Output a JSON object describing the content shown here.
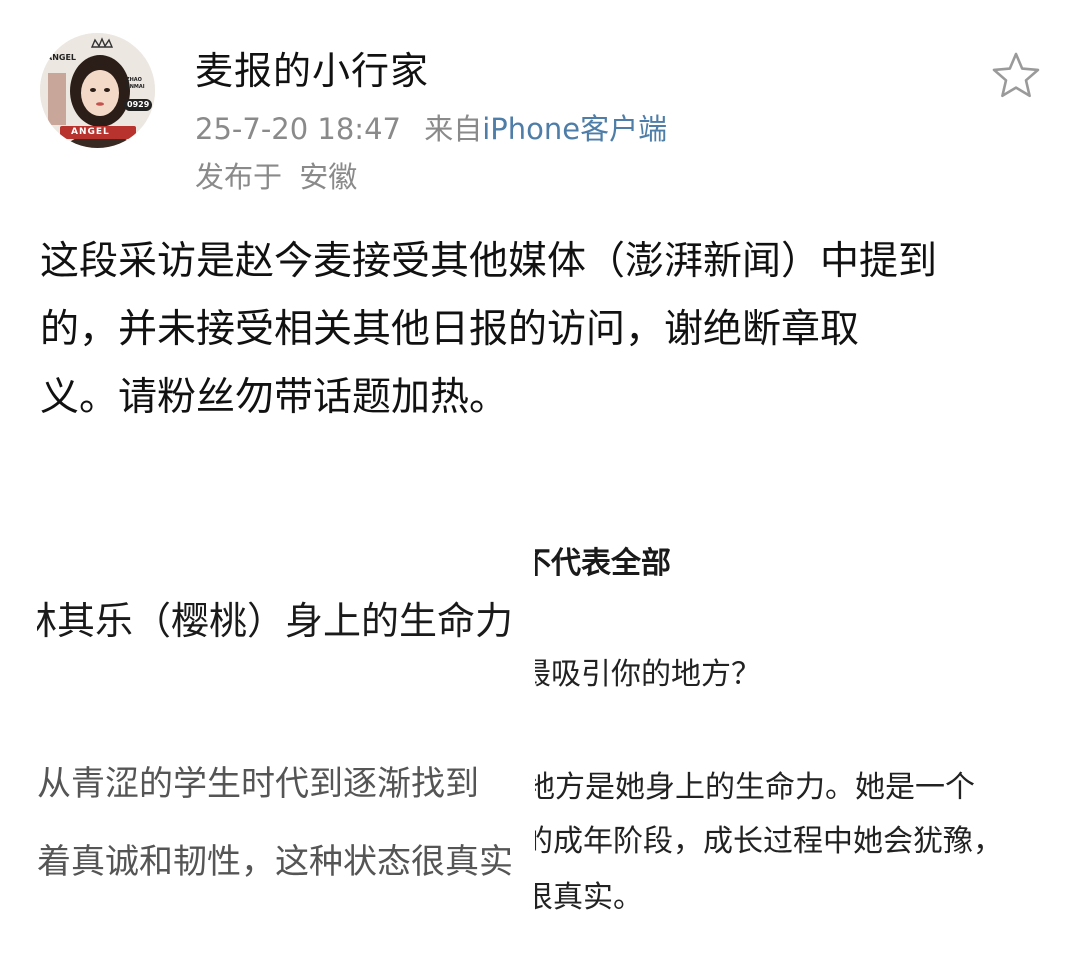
{
  "post": {
    "author": {
      "name": "麦报的小行家",
      "avatar_badge": "ANGEL",
      "avatar_side_text": "ZHAO JINMAI",
      "avatar_number": "0929"
    },
    "timestamp": "25-7-20 18:47",
    "source_prefix": "来自",
    "source": "iPhone客户端",
    "location_label": "发布于",
    "location": "安徽",
    "favorite_icon": "star-outline-icon",
    "body_lines": [
      "这段采访是赵今麦接受其他媒体（澎湃新闻）中提到",
      "的，并未接受相关其他日报的访问，谢绝断章取",
      "义。请粉丝勿带话题加热。"
    ]
  },
  "embedded_screenshots": {
    "left": {
      "title": "林其乐（樱桃）身上的生命力",
      "line1": "从青涩的学生时代到逐渐找到",
      "line2": "着真诚和韧性，这种状态很真实"
    },
    "right": {
      "heading": "不代表全部",
      "question": "最吸引你的地方？",
      "line1": "地方是她身上的生命力。她是一个",
      "line2": "的成年阶段，成长过程中她会犹豫，",
      "line3": "很真实。"
    }
  },
  "colors": {
    "text": "#111111",
    "meta": "#8a8a8a",
    "source_link": "#4e7ea8",
    "icon_stroke": "#9a9a9a"
  }
}
